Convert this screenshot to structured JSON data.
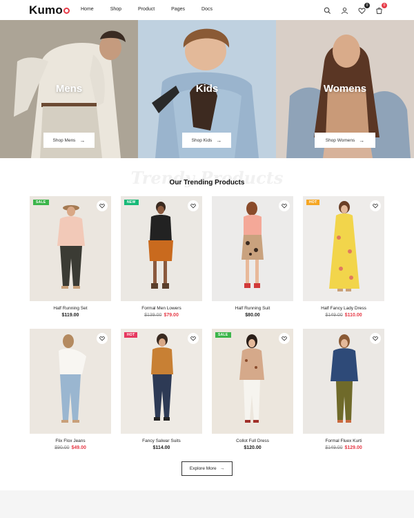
{
  "header": {
    "logo_text": "Kumo",
    "nav": [
      "Home",
      "Shop",
      "Product",
      "Pages",
      "Docs"
    ],
    "wishlist_count": "0",
    "cart_count": "0"
  },
  "banners": [
    {
      "title": "Mens",
      "button": "Shop Mens"
    },
    {
      "title": "Kids",
      "button": "Shop Kids"
    },
    {
      "title": "Womens",
      "button": "Shop Womens"
    }
  ],
  "trending": {
    "bg_text": "Trendy Products",
    "title": "Our Trending Products",
    "products": [
      {
        "name": "Half Running Set",
        "price": "$119.00",
        "old_price": "",
        "tag": "SALE"
      },
      {
        "name": "Formal Men Lowers",
        "price": "$79.00",
        "old_price": "$139.00",
        "tag": "NEW"
      },
      {
        "name": "Half Running Suit",
        "price": "$80.00",
        "old_price": "",
        "tag": ""
      },
      {
        "name": "Half Fancy Lady Dress",
        "price": "$110.00",
        "old_price": "$149.00",
        "tag": "HOT"
      },
      {
        "name": "Flix Flox Jeans",
        "price": "$49.00",
        "old_price": "$90.00",
        "tag": ""
      },
      {
        "name": "Fancy Salwar Suits",
        "price": "$114.00",
        "old_price": "",
        "tag": "HOT"
      },
      {
        "name": "Collot Full Dress",
        "price": "$120.00",
        "old_price": "",
        "tag": "SALE"
      },
      {
        "name": "Formal Fluex Kurti",
        "price": "$129.00",
        "old_price": "$149.00",
        "tag": ""
      }
    ],
    "explore_label": "Explore More"
  },
  "colors": {
    "accent_red": "#e63946",
    "sale_green": "#3bb54a",
    "new_green": "#17b978",
    "hot_orange": "#f5a623",
    "hot_pink": "#e63960"
  }
}
